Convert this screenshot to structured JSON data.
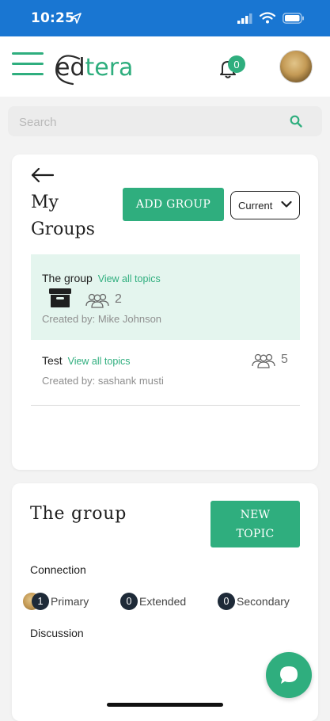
{
  "status_bar": {
    "time": "10:25"
  },
  "header": {
    "logo_ed": "ed",
    "logo_tera": "tera",
    "notification_count": "0"
  },
  "search": {
    "placeholder": "Search"
  },
  "my_groups": {
    "title": "My Groups",
    "add_group_label": "ADD GROUP",
    "filter_value": "Current",
    "groups": [
      {
        "name": "The group",
        "link": "View all topics",
        "member_count": "2",
        "created_by": "Created by: Mike Johnson",
        "selected": true
      },
      {
        "name": "Test",
        "link": "View all topics",
        "member_count": "5",
        "created_by": "Created by: sashank musti",
        "selected": false
      }
    ]
  },
  "group_detail": {
    "title": "The group",
    "new_topic_line1": "NEW",
    "new_topic_line2": "TOPIC",
    "connection_label": "Connection",
    "connections": [
      {
        "count": "1",
        "label": "Primary"
      },
      {
        "count": "0",
        "label": "Extended"
      },
      {
        "count": "0",
        "label": "Secondary"
      }
    ],
    "discussion_label": "Discussion"
  },
  "colors": {
    "accent": "#2fae7e",
    "status_bar": "#1976d2",
    "selected_row": "#e4f5ee",
    "badge_dark": "#1e2a38"
  },
  "icons": [
    "location-arrow-icon",
    "signal-icon",
    "wifi-icon",
    "battery-icon",
    "menu-icon",
    "bell-icon",
    "search-icon",
    "back-arrow-icon",
    "chevron-down-icon",
    "archive-icon",
    "people-icon",
    "chat-icon"
  ]
}
